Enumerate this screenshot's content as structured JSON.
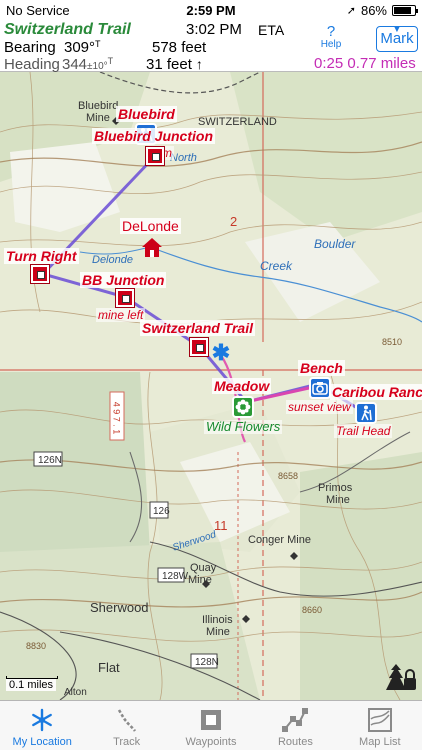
{
  "status": {
    "carrier": "No Service",
    "time": "2:59 PM",
    "battery": "86%",
    "battery_level": 0.86
  },
  "header": {
    "route_name": "Switzerland Trail",
    "eta_time": "3:02 PM",
    "eta_label": "ETA",
    "bearing_label": "Bearing",
    "bearing_value": "309°",
    "bearing_unit": "T",
    "heading_label": "Heading",
    "heading_value": "344",
    "heading_tolerance": "±10°",
    "heading_unit": "T",
    "distance_to_next": "578 feet",
    "distance_vertical": "31 feet",
    "help_label": "Help",
    "mark_label": "Mark",
    "remaining": "0:25  0.77 miles",
    "colors": {
      "title": "#2a8a3a",
      "accent": "#1a7ae0",
      "remaining": "#c42cb5"
    }
  },
  "map": {
    "waypoints": {
      "bluebird": "Bluebird",
      "bluebird_junction": "Bluebird Junction",
      "bluebird_junction_note": "m",
      "delonde": "DeLonde",
      "turn_right": "Turn Right",
      "bb_junction": "BB Junction",
      "bb_junction_note": "mine left",
      "switzerland_trail": "Switzerland Trail",
      "meadow": "Meadow",
      "meadow_note": "Wild Flowers",
      "bench": "Bench",
      "caribou_ranch": "Caribou Ranch",
      "caribou_note": "sunset view",
      "trail_head": "Trail Head"
    },
    "topo_labels": {
      "bluebird_mine": "Bluebird",
      "bluebird_mine2": "Mine",
      "switzerland": "SWITZERLAND",
      "north": "North",
      "section2": "2",
      "delonde_map": "Delonde",
      "creek": "Creek",
      "boulder": "Boulder",
      "elev_8510": "8510",
      "elev_8658": "8658",
      "primos": "Primos",
      "primos2": "Mine",
      "section11": "11",
      "conger": "Conger Mine",
      "quay": "Quay",
      "quay2": "Mine",
      "sherwood": "Sherwood",
      "sherwood2": "Sherwood",
      "illinois": "Illinois",
      "illinois2": "Mine",
      "flat": "Flat",
      "alton": "Alton",
      "elev_8830": "8830",
      "elev_8660": "8660",
      "road_126n": "126N",
      "road_126": "126",
      "road_128w": "128W",
      "road_128n": "128N",
      "road_4971": "4 9 7 . 1"
    },
    "scale_label": "0.1 miles"
  },
  "tabs": [
    {
      "label": "My Location",
      "icon": "snowflake-location-icon",
      "active": true
    },
    {
      "label": "Track",
      "icon": "track-icon",
      "active": false
    },
    {
      "label": "Waypoints",
      "icon": "waypoint-square-icon",
      "active": false
    },
    {
      "label": "Routes",
      "icon": "routes-icon",
      "active": false
    },
    {
      "label": "Map List",
      "icon": "map-list-icon",
      "active": false
    }
  ]
}
